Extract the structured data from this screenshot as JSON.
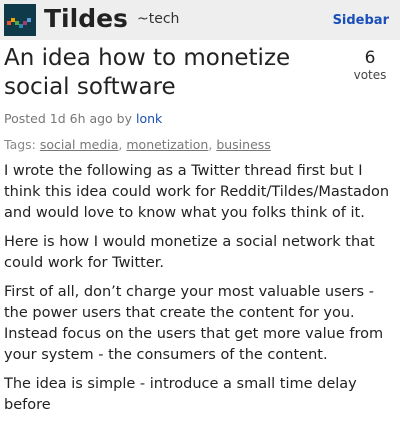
{
  "header": {
    "site_title": "Tildes",
    "group": "~tech",
    "sidebar_label": "Sidebar"
  },
  "topic": {
    "title": "An idea how to monetize social software",
    "votes": "6",
    "votes_label": "votes",
    "posted_prefix": "Posted 1d 6h ago by",
    "author": "lonk",
    "tags_label": "Tags:",
    "tags": [
      "social media",
      "monetization",
      "business"
    ],
    "paragraphs": [
      "I wrote the following as a Twitter thread first but I think this idea could work for Reddit/Tildes/Mastadon and would love to know what you folks think of it.",
      "Here is how I would monetize a social network that could work for Twitter.",
      "First of all, don’t charge your most valuable users - the power users that create the content for you. Instead focus on the users that get more value from your system - the consumers of the content.",
      "The idea is simple - introduce a small time delay before"
    ]
  },
  "colors": {
    "header_bg": "#eeeeee",
    "link": "#1a4fb8",
    "muted": "#777777"
  },
  "icons": {
    "logo": "tildes-logo-icon"
  }
}
